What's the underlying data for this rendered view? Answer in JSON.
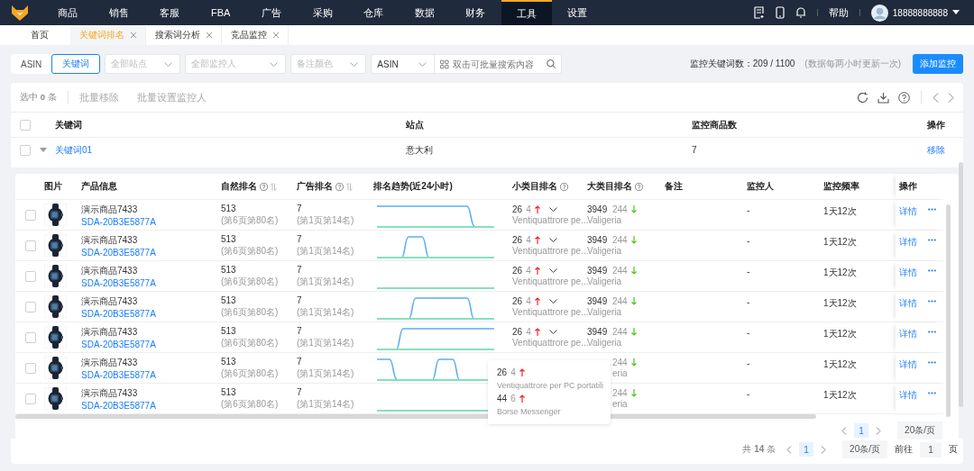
{
  "nav": {
    "items": [
      {
        "label": "商品",
        "selected": false
      },
      {
        "label": "销售",
        "selected": false
      },
      {
        "label": "客服",
        "selected": false
      },
      {
        "label": "FBA",
        "selected": false
      },
      {
        "label": "广告",
        "selected": false
      },
      {
        "label": "采购",
        "selected": false
      },
      {
        "label": "仓库",
        "selected": false
      },
      {
        "label": "数据",
        "selected": false
      },
      {
        "label": "财务",
        "selected": false
      },
      {
        "label": "工具",
        "selected": true
      },
      {
        "label": "设置",
        "selected": false
      }
    ],
    "help": "帮助",
    "user": "18888888888"
  },
  "tabs": [
    {
      "label": "首页",
      "selected": false,
      "closable": false
    },
    {
      "label": "关键词排名",
      "selected": true,
      "closable": true
    },
    {
      "label": "搜索词分析",
      "selected": false,
      "closable": true
    },
    {
      "label": "竞品监控",
      "selected": false,
      "closable": true
    }
  ],
  "filters": {
    "modes": [
      {
        "label": "ASIN",
        "selected": false
      },
      {
        "label": "关键词",
        "selected": true
      }
    ],
    "selects": [
      {
        "placeholder": "全部站点"
      },
      {
        "placeholder": "全部监控人"
      },
      {
        "placeholder": "备注颜色"
      }
    ],
    "search_type": "ASIN",
    "search_placeholder": "双击可批量搜索内容",
    "quota": "监控关键词数：209 / 1100",
    "quota_note": "(数据每两小时更新一次)",
    "add_button": "添加监控"
  },
  "toolbar": {
    "selected_count": "选中 **0** 条",
    "actions": [
      {
        "label": "批量移除",
        "disabled": true
      },
      {
        "label": "批量设置监控人",
        "disabled": true
      }
    ]
  },
  "table": {
    "select_all_checked": false,
    "columns": [
      "关键词",
      "站点",
      "监控商品数",
      "操作"
    ],
    "groups": [
      {
        "keyword": "关键词01",
        "site": "意大利",
        "count": "7",
        "action": "移除",
        "checked": false,
        "expanded": true
      }
    ]
  },
  "products": {
    "columns": [
      {
        "label": "图片",
        "help": false,
        "sortable": false
      },
      {
        "label": "产品信息",
        "help": false,
        "sortable": false
      },
      {
        "label": "自然排名",
        "help": true,
        "sortable": true
      },
      {
        "label": "广告排名",
        "help": true,
        "sortable": true
      },
      {
        "label": "排名趋势(近24小时)",
        "help": false,
        "sortable": false
      },
      {
        "label": "小类目排名",
        "help": true,
        "sortable": false
      },
      {
        "label": "大类目排名",
        "help": true,
        "sortable": false
      },
      {
        "label": "备注",
        "help": false,
        "sortable": false
      },
      {
        "label": "监控人",
        "help": false,
        "sortable": false
      },
      {
        "label": "监控频率",
        "help": false,
        "sortable": false
      },
      {
        "label": "操作",
        "help": false,
        "sortable": false
      }
    ],
    "rows": [
      {
        "checked": false,
        "name": "演示商品7433",
        "sku": "SDA-20B3E5877A",
        "natural": "513",
        "natural_sub": "(第6页第80名)",
        "ad": "7",
        "ad_sub": "(第1页第14名)",
        "trend": {
          "kind": "drop-late"
        },
        "small_rank": "26",
        "small_change": {
          "value": "4",
          "kind": "up"
        },
        "small_category": "Ventiquattrore pe...",
        "big_rank": "3949",
        "big_change": {
          "value": "244",
          "kind": "down"
        },
        "big_category": "Valigeria",
        "person": "-",
        "freq": "1天12次",
        "action": "详情"
      },
      {
        "checked": false,
        "name": "演示商品7433",
        "sku": "SDA-20B3E5877A",
        "natural": "513",
        "natural_sub": "(第6页第80名)",
        "ad": "7",
        "ad_sub": "(第1页第14名)",
        "trend": {
          "kind": "narrow-bump"
        },
        "small_rank": "26",
        "small_change": {
          "value": "4",
          "kind": "up"
        },
        "small_category": "Ventiquattrore pe...",
        "big_rank": "3949",
        "big_change": {
          "value": "244",
          "kind": "down"
        },
        "big_category": "Valigeria",
        "person": "-",
        "freq": "1天12次",
        "action": "详情"
      },
      {
        "checked": false,
        "name": "演示商品7433",
        "sku": "SDA-20B3E5877A",
        "natural": "513",
        "natural_sub": "(第6页第80名)",
        "ad": "7",
        "ad_sub": "(第1页第14名)",
        "trend": {
          "kind": "flat"
        },
        "small_rank": "26",
        "small_change": {
          "value": "4",
          "kind": "up"
        },
        "small_category": "Ventiquattrore pe...",
        "big_rank": "3949",
        "big_change": {
          "value": "244",
          "kind": "down"
        },
        "big_category": "Valigeria",
        "person": "-",
        "freq": "1天12次",
        "action": "详情"
      },
      {
        "checked": false,
        "name": "演示商品7433",
        "sku": "SDA-20B3E5877A",
        "natural": "513",
        "natural_sub": "(第6页第80名)",
        "ad": "7",
        "ad_sub": "(第1页第14名)",
        "trend": {
          "kind": "wide-bump"
        },
        "small_rank": "26",
        "small_change": {
          "value": "4",
          "kind": "up"
        },
        "small_category": "Ventiquattrore pe...",
        "big_rank": "3949",
        "big_change": {
          "value": "244",
          "kind": "down"
        },
        "big_category": "Valigeria",
        "person": "-",
        "freq": "1天12次",
        "action": "详情"
      },
      {
        "checked": false,
        "name": "演示商品7433",
        "sku": "SDA-20B3E5877A",
        "natural": "513",
        "natural_sub": "(第6页第80名)",
        "ad": "7",
        "ad_sub": "(第1页第14名)",
        "trend": {
          "kind": "rise"
        },
        "small_rank": "26",
        "small_change": {
          "value": "4",
          "kind": "up"
        },
        "small_category": "Ventiquattrore pe...",
        "big_rank": "3949",
        "big_change": {
          "value": "244",
          "kind": "down"
        },
        "big_category": "Valigeria",
        "person": "-",
        "freq": "1天12次",
        "action": "详情"
      },
      {
        "checked": false,
        "name": "演示商品7433",
        "sku": "SDA-20B3E5877A",
        "natural": "513",
        "natural_sub": "(第6页第80名)",
        "ad": "7",
        "ad_sub": "(第1页第14名)",
        "trend": {
          "kind": "drop-bump"
        },
        "big_change": {
          "value": "244",
          "kind": "down"
        },
        "big_category": "eria",
        "person": "-",
        "freq": "1天12次",
        "action": "详情"
      },
      {
        "checked": false,
        "name": "演示商品7433",
        "sku": "SDA-20B3E5877A",
        "natural": "513",
        "natural_sub": "(第6页第80名)",
        "ad": "7",
        "ad_sub": "(第1页第14名)",
        "trend": {
          "kind": "flat"
        },
        "big_change": {
          "value": "244",
          "kind": "down"
        },
        "big_category": "eria",
        "person": "-",
        "freq": "1天12次",
        "action": "详情"
      }
    ],
    "page": "1",
    "page_size": "20条/页",
    "tooltip": [
      {
        "rank": "26",
        "change": {
          "value": "4",
          "kind": "up"
        },
        "category": "Ventiquattrore per PC portatili"
      },
      {
        "rank": "44",
        "change": {
          "value": "6",
          "kind": "up"
        },
        "category": "Borse Messenger"
      }
    ]
  },
  "footer": {
    "total": "共 **14** 条",
    "page": "1",
    "page_size": "20条/页",
    "goto": "前往",
    "goto_value": "1",
    "goto_unit": "页"
  }
}
